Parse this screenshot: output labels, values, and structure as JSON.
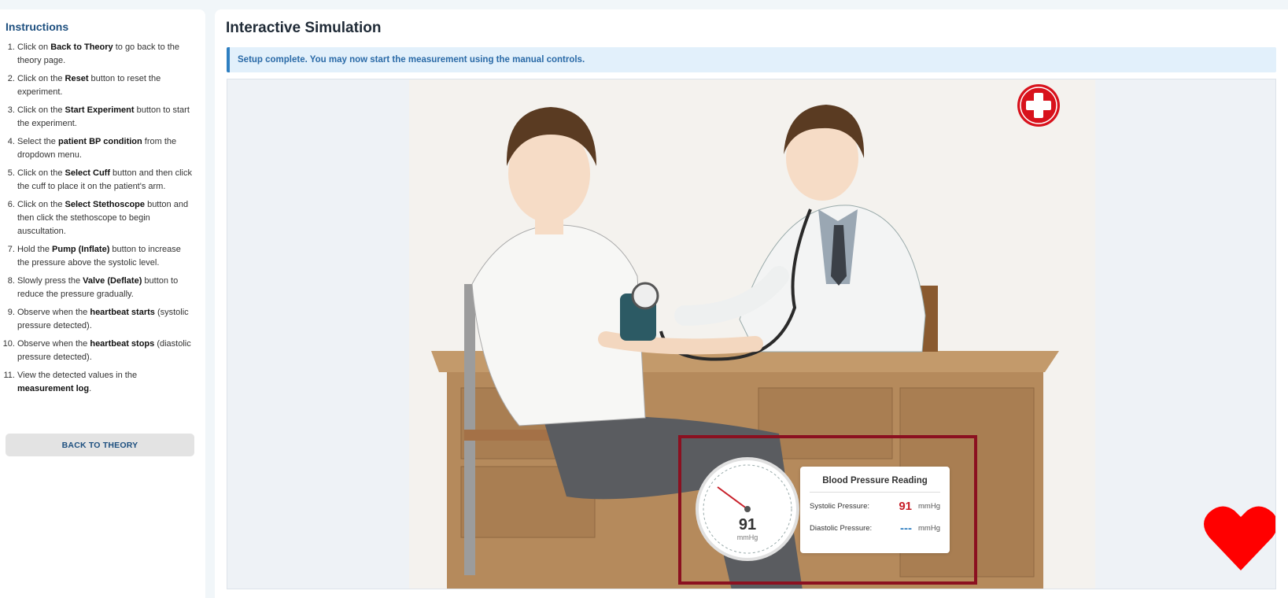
{
  "sidebar": {
    "title": "Instructions",
    "steps": [
      {
        "pre": "Click on ",
        "bold": "Back to Theory",
        "post": " to go back to the theory page."
      },
      {
        "pre": "Click on the ",
        "bold": "Reset",
        "post": " button to reset the experiment."
      },
      {
        "pre": "Click on the ",
        "bold": "Start Experiment",
        "post": " button to start the experiment."
      },
      {
        "pre": "Select the ",
        "bold": "patient BP condition",
        "post": " from the dropdown menu."
      },
      {
        "pre": "Click on the ",
        "bold": "Select Cuff",
        "post": " button and then click the cuff to place it on the patient's arm."
      },
      {
        "pre": "Click on the ",
        "bold": "Select Stethoscope",
        "post": " button and then click the stethoscope to begin auscultation."
      },
      {
        "pre": "Hold the ",
        "bold": "Pump (Inflate)",
        "post": " button to increase the pressure above the systolic level."
      },
      {
        "pre": "Slowly press the ",
        "bold": "Valve (Deflate)",
        "post": " button to reduce the pressure gradually."
      },
      {
        "pre": "Observe when the ",
        "bold": "heartbeat starts",
        "post": " (systolic pressure detected)."
      },
      {
        "pre": "Observe when the ",
        "bold": "heartbeat stops",
        "post": " (diastolic pressure detected)."
      },
      {
        "pre": "View the detected values in the ",
        "bold": "measurement log",
        "post": "."
      }
    ],
    "back_button": "BACK TO THEORY"
  },
  "main": {
    "title": "Interactive Simulation",
    "alert": "Setup complete. You may now start the measurement using the manual controls."
  },
  "gauge": {
    "value": "91",
    "unit": "mmHg",
    "pressure": 91
  },
  "reading": {
    "title": "Blood Pressure Reading",
    "systolic_label": "Systolic Pressure:",
    "systolic_value": "91",
    "systolic_unit": "mmHg",
    "diastolic_label": "Diastolic Pressure:",
    "diastolic_value": "---",
    "diastolic_unit": "mmHg"
  },
  "colors": {
    "accent": "#1d4f7f",
    "alert_text": "#2a6aa7",
    "systolic": "#c8202a",
    "diastolic": "#2f7fc1",
    "highlight_border": "#8b1020",
    "heart": "#ff0000"
  },
  "icons": [
    "red-cross-icon",
    "heart-icon",
    "pressure-gauge-icon"
  ]
}
